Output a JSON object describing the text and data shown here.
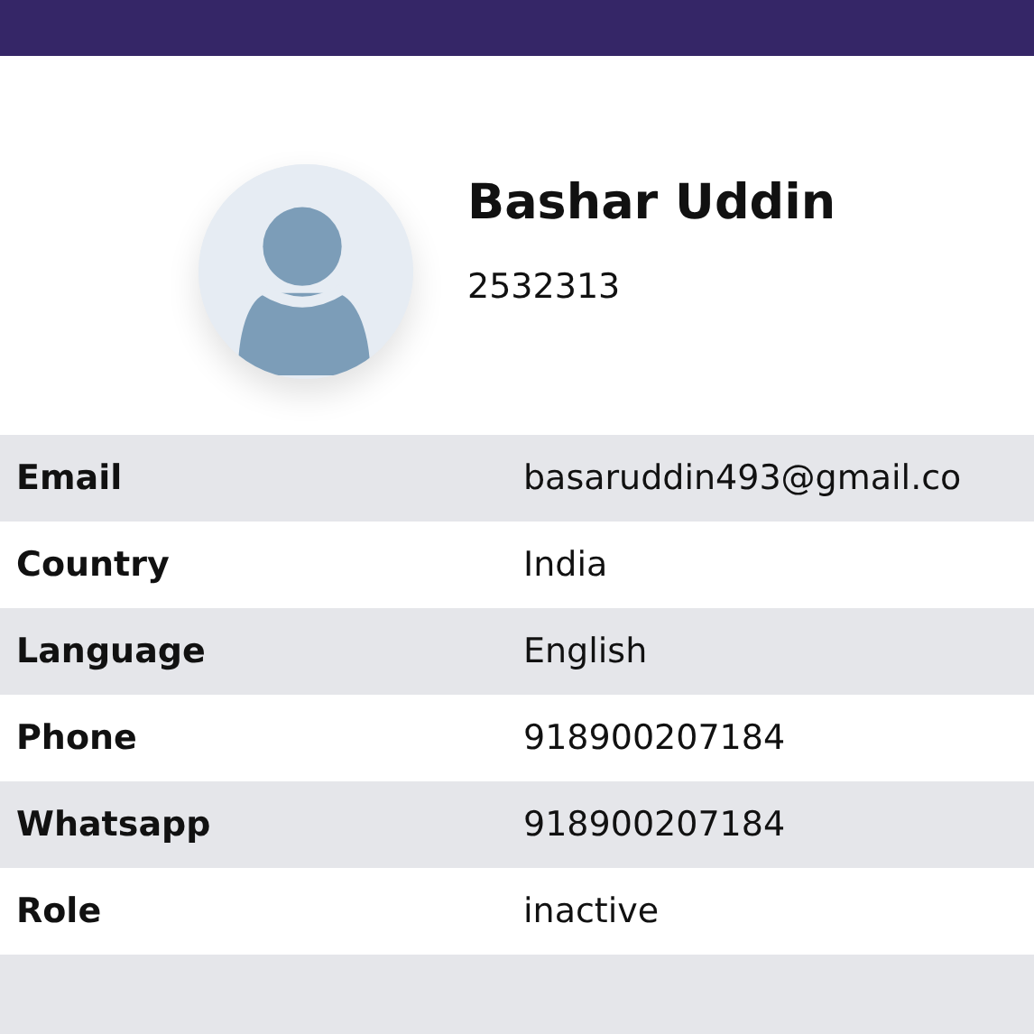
{
  "profile": {
    "name": "Bashar Uddin",
    "id": "2532313"
  },
  "details": [
    {
      "label": "Email",
      "value": "basaruddin493@gmail.co"
    },
    {
      "label": "Country",
      "value": "India"
    },
    {
      "label": "Language",
      "value": "English"
    },
    {
      "label": "Phone",
      "value": "918900207184"
    },
    {
      "label": "Whatsapp",
      "value": "918900207184"
    },
    {
      "label": "Role",
      "value": "inactive"
    }
  ]
}
